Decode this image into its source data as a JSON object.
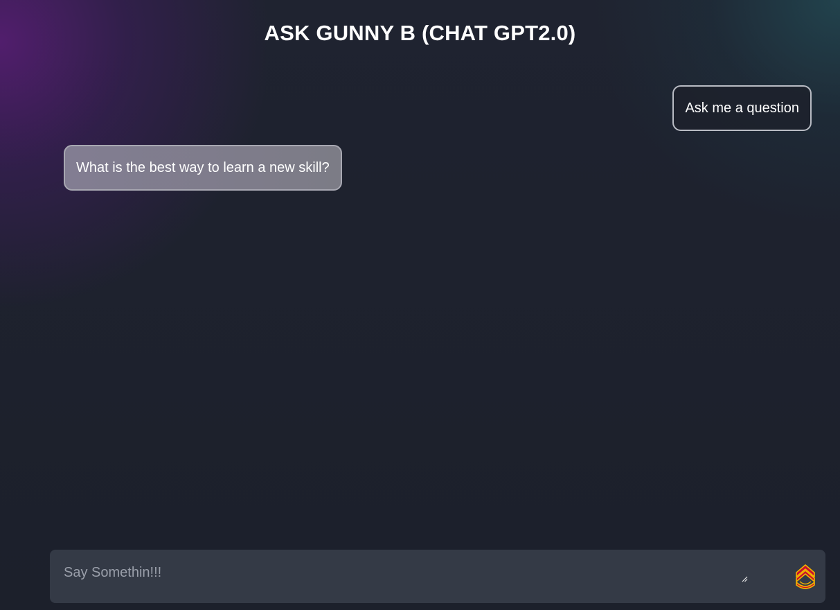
{
  "header": {
    "title": "ASK GUNNY B (CHAT GPT2.0)"
  },
  "messages": [
    {
      "role": "bot",
      "text": "Ask me a question"
    },
    {
      "role": "user",
      "text": "What is the best way to learn a new skill?"
    }
  ],
  "composer": {
    "placeholder": "Say Somethin!!!",
    "value": "",
    "send_icon": "sergeant-chevron-icon"
  },
  "colors": {
    "background": "#1d212c",
    "gradient_purple": "#541e70",
    "gradient_teal": "#224650",
    "composer_bg": "#343a46",
    "chevron_red": "#c8102e",
    "chevron_gold": "#f2b300"
  }
}
